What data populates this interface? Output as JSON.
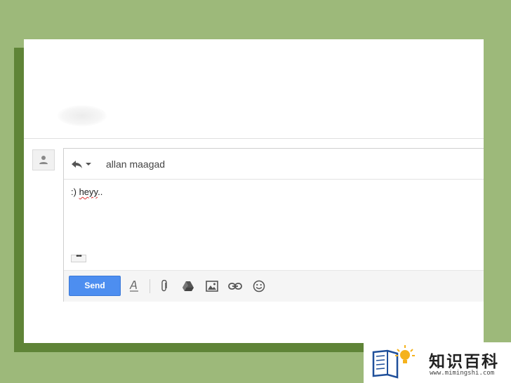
{
  "reply": {
    "recipient": "allan maagad",
    "body_prefix": ":)",
    "body_word": "heyy",
    "body_suffix": "..",
    "more_label": "•••"
  },
  "toolbar": {
    "send_label": "Send",
    "icons": [
      "format-text-icon",
      "attach-icon",
      "drive-icon",
      "insert-photo-icon",
      "link-icon",
      "emoji-icon"
    ]
  },
  "watermark": {
    "brand_cn": "知识百科",
    "url": "www.mimingshi.com"
  },
  "colors": {
    "background": "#9db97a",
    "frame_shadow": "#5f8437",
    "send_button": "#4d8ef0"
  }
}
